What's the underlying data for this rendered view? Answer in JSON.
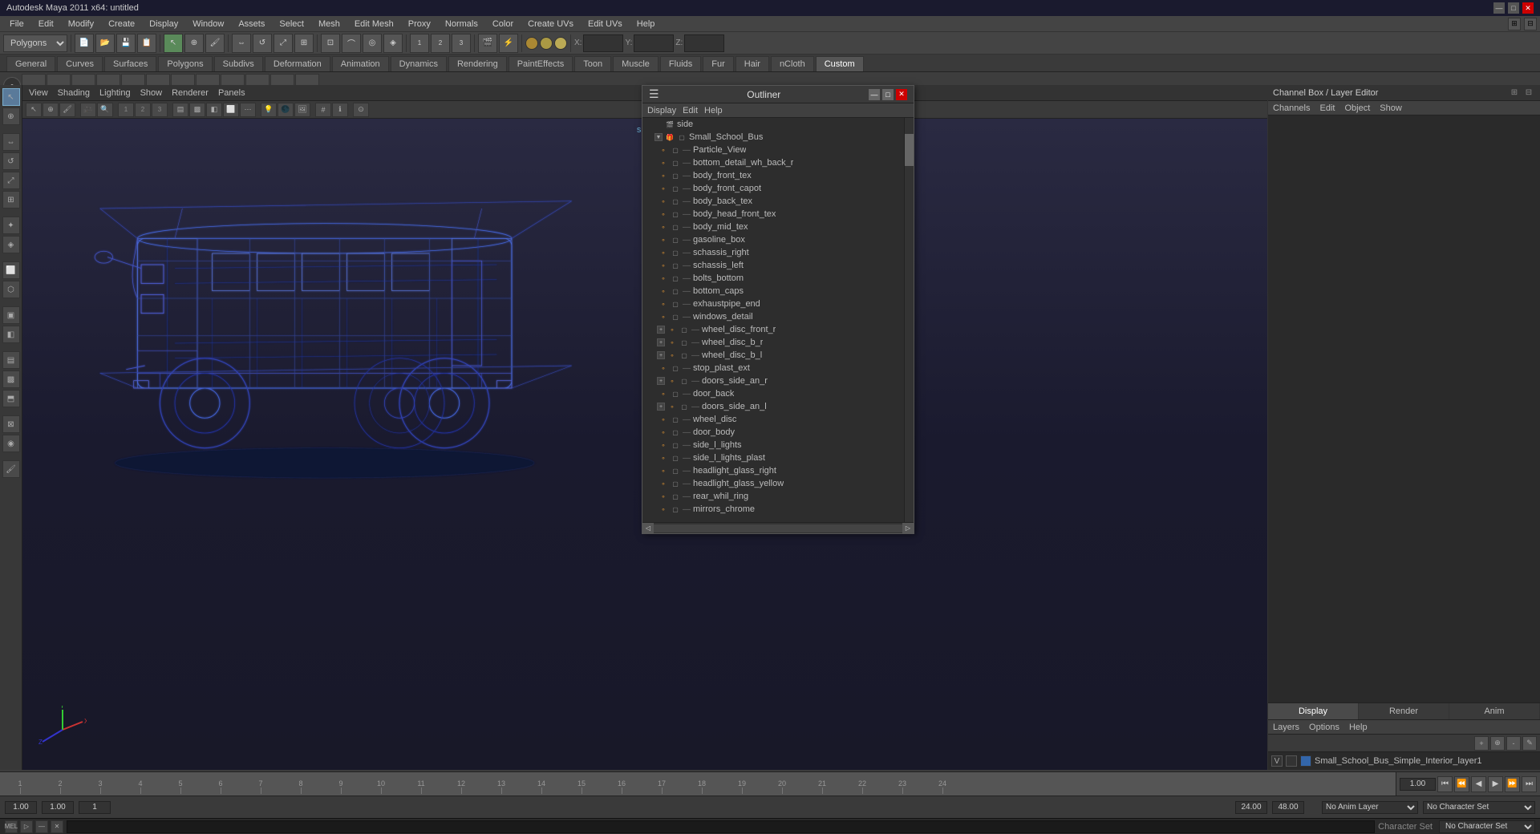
{
  "app": {
    "title": "Autodesk Maya 2011 x64: untitled"
  },
  "titlebar": {
    "title": "Autodesk Maya 2011 x64: untitled",
    "minimize": "—",
    "maximize": "□",
    "close": "✕"
  },
  "menubar": {
    "items": [
      "File",
      "Edit",
      "Modify",
      "Create",
      "Display",
      "Window",
      "Assets",
      "Select",
      "Mesh",
      "Edit Mesh",
      "Proxy",
      "Normals",
      "Color",
      "Create UVs",
      "Edit UVs",
      "Help"
    ]
  },
  "toolbar1": {
    "workspace_label": "Polygons"
  },
  "shelf_tabs": {
    "items": [
      "General",
      "Curves",
      "Surfaces",
      "Polygons",
      "Subdivs",
      "Deformation",
      "Animation",
      "Dynamics",
      "Rendering",
      "PaintEffects",
      "Toon",
      "Muscle",
      "Fluids",
      "Fur",
      "Hair",
      "nCloth",
      "Custom"
    ],
    "active": "Custom"
  },
  "viewport": {
    "menus": [
      "View",
      "Shading",
      "Lighting",
      "Show",
      "Renderer",
      "Panels"
    ],
    "status_text": "side"
  },
  "outliner": {
    "title": "Outliner",
    "menus": [
      "Display",
      "Edit",
      "Help"
    ],
    "items": [
      {
        "name": "side",
        "type": "scene",
        "level": 0,
        "expand": false
      },
      {
        "name": "Small_School_Bus",
        "type": "mesh",
        "level": 1,
        "expand": true
      },
      {
        "name": "Particle_View",
        "type": "particle",
        "level": 2,
        "expand": false
      },
      {
        "name": "bottom_detail_wh_back_r",
        "type": "mesh",
        "level": 2,
        "expand": false
      },
      {
        "name": "body_front_tex",
        "type": "mesh",
        "level": 2,
        "expand": false
      },
      {
        "name": "body_front_capot",
        "type": "mesh",
        "level": 2,
        "expand": false
      },
      {
        "name": "body_back_tex",
        "type": "mesh",
        "level": 2,
        "expand": false
      },
      {
        "name": "body_head_front_tex",
        "type": "mesh",
        "level": 2,
        "expand": false
      },
      {
        "name": "body_mid_tex",
        "type": "mesh",
        "level": 2,
        "expand": false
      },
      {
        "name": "gasoline_box",
        "type": "mesh",
        "level": 2,
        "expand": false
      },
      {
        "name": "schassis_right",
        "type": "mesh",
        "level": 2,
        "expand": false
      },
      {
        "name": "schassis_left",
        "type": "mesh",
        "level": 2,
        "expand": false
      },
      {
        "name": "bolts_bottom",
        "type": "mesh",
        "level": 2,
        "expand": false
      },
      {
        "name": "bottom_caps",
        "type": "mesh",
        "level": 2,
        "expand": false
      },
      {
        "name": "exhaustpipe_end",
        "type": "mesh",
        "level": 2,
        "expand": false
      },
      {
        "name": "windows_detail",
        "type": "mesh",
        "level": 2,
        "expand": false
      },
      {
        "name": "wheel_disc_front_r",
        "type": "mesh",
        "level": 2,
        "expand": true
      },
      {
        "name": "wheel_disc_b_r",
        "type": "mesh",
        "level": 2,
        "expand": true
      },
      {
        "name": "wheel_disc_b_l",
        "type": "mesh",
        "level": 2,
        "expand": true
      },
      {
        "name": "stop_plast_ext",
        "type": "mesh",
        "level": 2,
        "expand": false
      },
      {
        "name": "doors_side_an_r",
        "type": "mesh",
        "level": 2,
        "expand": true
      },
      {
        "name": "door_back",
        "type": "mesh",
        "level": 2,
        "expand": false
      },
      {
        "name": "doors_side_an_l",
        "type": "mesh",
        "level": 2,
        "expand": true
      },
      {
        "name": "wheel_disc",
        "type": "mesh",
        "level": 2,
        "expand": false
      },
      {
        "name": "door_body",
        "type": "mesh",
        "level": 2,
        "expand": false
      },
      {
        "name": "side_l_lights",
        "type": "mesh",
        "level": 2,
        "expand": false
      },
      {
        "name": "side_l_lights_plast",
        "type": "mesh",
        "level": 2,
        "expand": false
      },
      {
        "name": "headlight_glass_right",
        "type": "mesh",
        "level": 2,
        "expand": false
      },
      {
        "name": "headlight_glass_yellow",
        "type": "mesh",
        "level": 2,
        "expand": false
      },
      {
        "name": "rear_whil_ring",
        "type": "mesh",
        "level": 2,
        "expand": false
      },
      {
        "name": "mirrors_chrome",
        "type": "mesh",
        "level": 2,
        "expand": false
      }
    ]
  },
  "channel_box": {
    "title": "Channel Box / Layer Editor",
    "menus": [
      "Channels",
      "Edit",
      "Object",
      "Show"
    ],
    "tabs": [
      "Display",
      "Render",
      "Anim"
    ],
    "active_tab": "Display",
    "layer_menus": [
      "Layers",
      "Options",
      "Help"
    ],
    "layer_name": "Small_School_Bus_Simple_Interior_layer1",
    "layer_v": "V"
  },
  "timeline": {
    "marks": [
      "1",
      "2",
      "3",
      "4",
      "5",
      "6",
      "7",
      "8",
      "9",
      "10",
      "11",
      "12",
      "13",
      "14",
      "15",
      "16",
      "17",
      "18",
      "19",
      "20",
      "21",
      "22",
      "23",
      "24"
    ],
    "start_frame": "1.00",
    "playback_speed": "1.00",
    "frame_current": "1",
    "frame_end": "24",
    "time_end": "24.00",
    "last_frame": "48.00",
    "anim_layer": "No Anim Layer",
    "character_set_label": "Character Set",
    "character_set": "No Character Set",
    "frame_value": "1.00"
  },
  "mel": {
    "label": "MEL",
    "placeholder": ""
  },
  "left_tools": {
    "items": [
      {
        "icon": "↖",
        "name": "select-tool",
        "active": true
      },
      {
        "icon": "⊕",
        "name": "lasso-tool",
        "active": false
      },
      {
        "icon": "⇔",
        "name": "move-tool",
        "active": false
      },
      {
        "icon": "↺",
        "name": "rotate-tool",
        "active": false
      },
      {
        "icon": "⤢",
        "name": "scale-tool",
        "active": false
      },
      {
        "icon": "⊞",
        "name": "universal-tool",
        "active": false
      },
      {
        "icon": "✦",
        "name": "soft-mod-tool",
        "active": false
      },
      {
        "icon": "◈",
        "name": "show-manip-tool",
        "active": false
      },
      {
        "sep": true
      },
      {
        "icon": "⬜",
        "name": "region-select",
        "active": false
      },
      {
        "icon": "⬡",
        "name": "paint-select",
        "active": false
      },
      {
        "sep": true
      },
      {
        "icon": "📷",
        "name": "camera-tool",
        "active": false
      },
      {
        "icon": "🔍",
        "name": "zoom-tool",
        "active": false
      },
      {
        "sep": true
      },
      {
        "icon": "▣",
        "name": "grid-display",
        "active": false
      },
      {
        "icon": "◧",
        "name": "quad-view",
        "active": false
      },
      {
        "icon": "◩",
        "name": "persp-view",
        "active": false
      },
      {
        "sep": true
      },
      {
        "icon": "⬒",
        "name": "hypergraph",
        "active": false
      },
      {
        "icon": "▤",
        "name": "render-view",
        "active": false
      },
      {
        "icon": "⊕",
        "name": "create-poly",
        "active": false
      },
      {
        "sep": true
      },
      {
        "icon": "⚙",
        "name": "settings",
        "active": false
      }
    ]
  }
}
